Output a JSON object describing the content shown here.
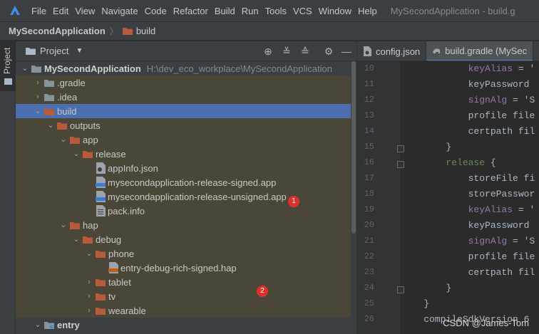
{
  "menubar": {
    "items": [
      "File",
      "Edit",
      "View",
      "Navigate",
      "Code",
      "Refactor",
      "Build",
      "Run",
      "Tools",
      "VCS",
      "Window",
      "Help"
    ],
    "window_title": "MySecondApplication - build.g"
  },
  "breadcrumb": {
    "project": "MySecondApplication",
    "folder": "build"
  },
  "stripe": {
    "label": "Project"
  },
  "project_panel": {
    "title": "Project",
    "tree": [
      {
        "label": "MySecondApplication",
        "path": "H:\\dev_eco_workplace\\MySecondApplication",
        "bold": true
      },
      {
        "label": ".gradle"
      },
      {
        "label": ".idea"
      },
      {
        "label": "build"
      },
      {
        "label": "outputs"
      },
      {
        "label": "app"
      },
      {
        "label": "release"
      },
      {
        "label": "appInfo.json"
      },
      {
        "label": "mysecondapplication-release-signed.app",
        "badge": "1"
      },
      {
        "label": "mysecondapplication-release-unsigned.app"
      },
      {
        "label": "pack.info"
      },
      {
        "label": "hap"
      },
      {
        "label": "debug"
      },
      {
        "label": "phone"
      },
      {
        "label": "entry-debug-rich-signed.hap",
        "badge": "2"
      },
      {
        "label": "tablet"
      },
      {
        "label": "tv"
      },
      {
        "label": "wearable"
      },
      {
        "label": "entry",
        "bold": true
      }
    ]
  },
  "editor": {
    "tabs": [
      {
        "label": "config.json"
      },
      {
        "label": "build.gradle (MySec"
      }
    ],
    "line_numbers": [
      "10",
      "11",
      "12",
      "13",
      "14",
      "15",
      "16",
      "17",
      "18",
      "19",
      "20",
      "21",
      "22",
      "23",
      "24",
      "25",
      "26"
    ],
    "lines": [
      {
        "p": "            ",
        "k": "keyAlias",
        "r": " = '",
        "c": "purple"
      },
      {
        "p": "            ",
        "k": "",
        "r": "keyPassword",
        "c": "plain"
      },
      {
        "p": "            ",
        "k": "signAlg",
        "r": " = 'S",
        "c": "purple"
      },
      {
        "p": "            ",
        "k": "",
        "r": "profile file",
        "c": "plain"
      },
      {
        "p": "            ",
        "k": "",
        "r": "certpath fil",
        "c": "plain"
      },
      {
        "p": "        ",
        "k": "",
        "r": "}",
        "c": "plain"
      },
      {
        "p": "        ",
        "k": "release",
        "r": " {",
        "c": "green"
      },
      {
        "p": "            ",
        "k": "",
        "r": "storeFile fi",
        "c": "plain"
      },
      {
        "p": "            ",
        "k": "",
        "r": "storePasswor",
        "c": "plain"
      },
      {
        "p": "            ",
        "k": "keyAlias",
        "r": " = '",
        "c": "purple"
      },
      {
        "p": "            ",
        "k": "",
        "r": "keyPassword",
        "c": "plain"
      },
      {
        "p": "            ",
        "k": "signAlg",
        "r": " = 'S",
        "c": "purple"
      },
      {
        "p": "            ",
        "k": "",
        "r": "profile file",
        "c": "plain"
      },
      {
        "p": "            ",
        "k": "",
        "r": "certpath fil",
        "c": "plain"
      },
      {
        "p": "        ",
        "k": "",
        "r": "}",
        "c": "plain"
      },
      {
        "p": "    ",
        "k": "",
        "r": "}",
        "c": "plain"
      },
      {
        "p": "    ",
        "k": "",
        "r": "compileSdkVersion 6",
        "c": "plain"
      }
    ],
    "watermark": "CSDN @James-Tom"
  },
  "colors": {
    "selection": "#4b6eaf",
    "folder": "#b85a3c",
    "badge": "#e0302e"
  }
}
